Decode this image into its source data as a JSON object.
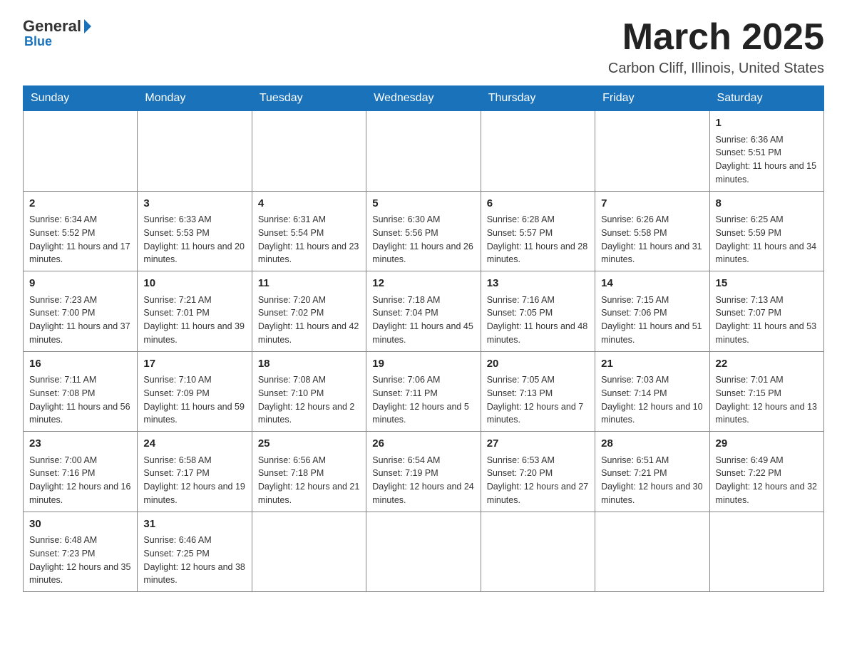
{
  "header": {
    "logo_general": "General",
    "logo_blue": "Blue",
    "month_title": "March 2025",
    "location": "Carbon Cliff, Illinois, United States"
  },
  "weekdays": [
    "Sunday",
    "Monday",
    "Tuesday",
    "Wednesday",
    "Thursday",
    "Friday",
    "Saturday"
  ],
  "weeks": [
    [
      {
        "day": "",
        "info": ""
      },
      {
        "day": "",
        "info": ""
      },
      {
        "day": "",
        "info": ""
      },
      {
        "day": "",
        "info": ""
      },
      {
        "day": "",
        "info": ""
      },
      {
        "day": "",
        "info": ""
      },
      {
        "day": "1",
        "info": "Sunrise: 6:36 AM\nSunset: 5:51 PM\nDaylight: 11 hours and 15 minutes."
      }
    ],
    [
      {
        "day": "2",
        "info": "Sunrise: 6:34 AM\nSunset: 5:52 PM\nDaylight: 11 hours and 17 minutes."
      },
      {
        "day": "3",
        "info": "Sunrise: 6:33 AM\nSunset: 5:53 PM\nDaylight: 11 hours and 20 minutes."
      },
      {
        "day": "4",
        "info": "Sunrise: 6:31 AM\nSunset: 5:54 PM\nDaylight: 11 hours and 23 minutes."
      },
      {
        "day": "5",
        "info": "Sunrise: 6:30 AM\nSunset: 5:56 PM\nDaylight: 11 hours and 26 minutes."
      },
      {
        "day": "6",
        "info": "Sunrise: 6:28 AM\nSunset: 5:57 PM\nDaylight: 11 hours and 28 minutes."
      },
      {
        "day": "7",
        "info": "Sunrise: 6:26 AM\nSunset: 5:58 PM\nDaylight: 11 hours and 31 minutes."
      },
      {
        "day": "8",
        "info": "Sunrise: 6:25 AM\nSunset: 5:59 PM\nDaylight: 11 hours and 34 minutes."
      }
    ],
    [
      {
        "day": "9",
        "info": "Sunrise: 7:23 AM\nSunset: 7:00 PM\nDaylight: 11 hours and 37 minutes."
      },
      {
        "day": "10",
        "info": "Sunrise: 7:21 AM\nSunset: 7:01 PM\nDaylight: 11 hours and 39 minutes."
      },
      {
        "day": "11",
        "info": "Sunrise: 7:20 AM\nSunset: 7:02 PM\nDaylight: 11 hours and 42 minutes."
      },
      {
        "day": "12",
        "info": "Sunrise: 7:18 AM\nSunset: 7:04 PM\nDaylight: 11 hours and 45 minutes."
      },
      {
        "day": "13",
        "info": "Sunrise: 7:16 AM\nSunset: 7:05 PM\nDaylight: 11 hours and 48 minutes."
      },
      {
        "day": "14",
        "info": "Sunrise: 7:15 AM\nSunset: 7:06 PM\nDaylight: 11 hours and 51 minutes."
      },
      {
        "day": "15",
        "info": "Sunrise: 7:13 AM\nSunset: 7:07 PM\nDaylight: 11 hours and 53 minutes."
      }
    ],
    [
      {
        "day": "16",
        "info": "Sunrise: 7:11 AM\nSunset: 7:08 PM\nDaylight: 11 hours and 56 minutes."
      },
      {
        "day": "17",
        "info": "Sunrise: 7:10 AM\nSunset: 7:09 PM\nDaylight: 11 hours and 59 minutes."
      },
      {
        "day": "18",
        "info": "Sunrise: 7:08 AM\nSunset: 7:10 PM\nDaylight: 12 hours and 2 minutes."
      },
      {
        "day": "19",
        "info": "Sunrise: 7:06 AM\nSunset: 7:11 PM\nDaylight: 12 hours and 5 minutes."
      },
      {
        "day": "20",
        "info": "Sunrise: 7:05 AM\nSunset: 7:13 PM\nDaylight: 12 hours and 7 minutes."
      },
      {
        "day": "21",
        "info": "Sunrise: 7:03 AM\nSunset: 7:14 PM\nDaylight: 12 hours and 10 minutes."
      },
      {
        "day": "22",
        "info": "Sunrise: 7:01 AM\nSunset: 7:15 PM\nDaylight: 12 hours and 13 minutes."
      }
    ],
    [
      {
        "day": "23",
        "info": "Sunrise: 7:00 AM\nSunset: 7:16 PM\nDaylight: 12 hours and 16 minutes."
      },
      {
        "day": "24",
        "info": "Sunrise: 6:58 AM\nSunset: 7:17 PM\nDaylight: 12 hours and 19 minutes."
      },
      {
        "day": "25",
        "info": "Sunrise: 6:56 AM\nSunset: 7:18 PM\nDaylight: 12 hours and 21 minutes."
      },
      {
        "day": "26",
        "info": "Sunrise: 6:54 AM\nSunset: 7:19 PM\nDaylight: 12 hours and 24 minutes."
      },
      {
        "day": "27",
        "info": "Sunrise: 6:53 AM\nSunset: 7:20 PM\nDaylight: 12 hours and 27 minutes."
      },
      {
        "day": "28",
        "info": "Sunrise: 6:51 AM\nSunset: 7:21 PM\nDaylight: 12 hours and 30 minutes."
      },
      {
        "day": "29",
        "info": "Sunrise: 6:49 AM\nSunset: 7:22 PM\nDaylight: 12 hours and 32 minutes."
      }
    ],
    [
      {
        "day": "30",
        "info": "Sunrise: 6:48 AM\nSunset: 7:23 PM\nDaylight: 12 hours and 35 minutes."
      },
      {
        "day": "31",
        "info": "Sunrise: 6:46 AM\nSunset: 7:25 PM\nDaylight: 12 hours and 38 minutes."
      },
      {
        "day": "",
        "info": ""
      },
      {
        "day": "",
        "info": ""
      },
      {
        "day": "",
        "info": ""
      },
      {
        "day": "",
        "info": ""
      },
      {
        "day": "",
        "info": ""
      }
    ]
  ]
}
